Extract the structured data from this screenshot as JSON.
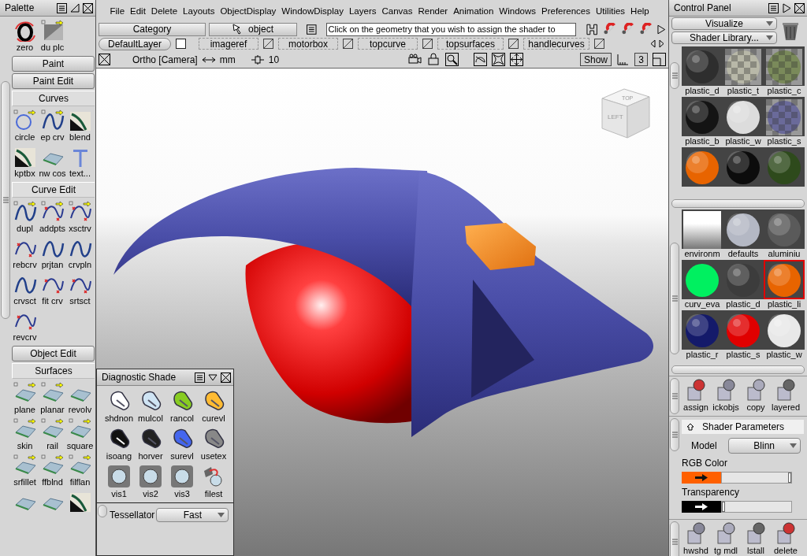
{
  "palette": {
    "title": "Palette",
    "top_tools": [
      {
        "label": "zero",
        "kind": "zero",
        "options": false
      },
      {
        "label": "du plc",
        "kind": "paper",
        "options": true
      }
    ],
    "sections": [
      {
        "title": "Paint",
        "expanded": false
      },
      {
        "title": "Paint Edit",
        "expanded": false
      },
      {
        "title": "Curves",
        "expanded": true,
        "tools": [
          {
            "label": "circle",
            "kind": "circle",
            "options": true
          },
          {
            "label": "ep crv",
            "kind": "curve",
            "options": true
          },
          {
            "label": "blend",
            "kind": "dark",
            "options": false
          },
          {
            "label": "kptbx",
            "kind": "dark",
            "options": false
          },
          {
            "label": "nw cos",
            "kind": "surface",
            "options": false
          },
          {
            "label": "text...",
            "kind": "text",
            "options": false
          }
        ]
      },
      {
        "title": "Curve Edit",
        "expanded": true,
        "tools": [
          {
            "label": "dupl",
            "kind": "curve",
            "options": true
          },
          {
            "label": "addpts",
            "kind": "edit",
            "options": true
          },
          {
            "label": "xsctrv",
            "kind": "edit",
            "options": true
          },
          {
            "label": "rebcrv",
            "kind": "edit",
            "options": false
          },
          {
            "label": "prjtan",
            "kind": "curve",
            "options": false
          },
          {
            "label": "crvpln",
            "kind": "curve",
            "options": false
          },
          {
            "label": "crvsct",
            "kind": "curve",
            "options": false
          },
          {
            "label": "fit crv",
            "kind": "edit",
            "options": false
          },
          {
            "label": "srtsct",
            "kind": "edit",
            "options": false
          },
          {
            "label": "revcrv",
            "kind": "edit",
            "options": false
          }
        ]
      },
      {
        "title": "Object Edit",
        "expanded": false
      },
      {
        "title": "Surfaces",
        "expanded": true,
        "tools": [
          {
            "label": "plane",
            "kind": "surface",
            "options": true
          },
          {
            "label": "planar",
            "kind": "surface",
            "options": true
          },
          {
            "label": "revolv",
            "kind": "surface",
            "options": false
          },
          {
            "label": "skin",
            "kind": "surface",
            "options": true
          },
          {
            "label": "rail",
            "kind": "surface",
            "options": true
          },
          {
            "label": "square",
            "kind": "surface",
            "options": true
          },
          {
            "label": "srfillet",
            "kind": "surface",
            "options": true
          },
          {
            "label": "ffblnd",
            "kind": "surface",
            "options": true
          },
          {
            "label": "filflan",
            "kind": "surface",
            "options": true
          },
          {
            "kind": "surface",
            "options": false
          },
          {
            "kind": "surface",
            "options": false
          },
          {
            "kind": "dark",
            "options": false
          }
        ]
      }
    ]
  },
  "menu": [
    "File",
    "Edit",
    "Delete",
    "Layouts",
    "ObjectDisplay",
    "WindowDisplay",
    "Layers",
    "Canvas",
    "Render",
    "Animation",
    "Windows",
    "Preferences",
    "Utilities",
    "Help"
  ],
  "toolbar": {
    "category": "Category",
    "pick_mode": "object",
    "prompt": "Click on the geometry that you wish to assign the shader to"
  },
  "layers": [
    {
      "name": "DefaultLayer",
      "kind": "default",
      "checked": false
    },
    {
      "name": "imageref",
      "kind": "layer"
    },
    {
      "name": "motorbox",
      "kind": "layer"
    },
    {
      "name": "topcurve",
      "kind": "layer"
    },
    {
      "name": "topsurfaces",
      "kind": "layer"
    },
    {
      "name": "handlecurves",
      "kind": "layer"
    }
  ],
  "view_bar": {
    "camera": "Ortho [Camera]",
    "units": "mm",
    "grid": "10",
    "show": "Show",
    "count": "3"
  },
  "viewport": {
    "view_cube": [
      "TOP",
      "LEFT"
    ]
  },
  "diagnostic": {
    "title": "Diagnostic Shade",
    "tools": [
      "shdnon",
      "mulcol",
      "rancol",
      "curevl",
      "isoang",
      "horver",
      "surevl",
      "usetex",
      "vis1",
      "vis2",
      "vis3",
      "filest"
    ],
    "tessellator_label": "Tessellator",
    "tessellator": "Fast"
  },
  "control_panel": {
    "title": "Control Panel",
    "mode": "Visualize",
    "library": "Shader Library...",
    "libraries": [
      {
        "swatches": [
          {
            "label": "plastic_d",
            "kind": "sphere",
            "color": "#2e2e2e",
            "selected": false
          },
          {
            "label": "plastic_t",
            "kind": "checker",
            "color": "#b8b8a8",
            "selected": false
          },
          {
            "label": "plastic_c",
            "kind": "checker",
            "color": "#7a8a5a",
            "selected": false
          },
          {
            "label": "plastic_b",
            "kind": "sphere",
            "color": "#141414",
            "selected": false
          },
          {
            "label": "plastic_w",
            "kind": "sphere",
            "color": "#dcdcdc",
            "selected": false
          },
          {
            "label": "plastic_s",
            "kind": "checker",
            "color": "#6a6a9a",
            "selected": false
          },
          {
            "kind": "sphere",
            "color": "#e86400",
            "selected": false
          },
          {
            "kind": "sphere",
            "color": "#0c0c0c",
            "selected": false
          },
          {
            "kind": "sphere",
            "color": "#2e4a1c",
            "selected": false
          }
        ]
      },
      {
        "swatches": [
          {
            "label": "environm",
            "kind": "ramp",
            "color": "#ffffff",
            "selected": false
          },
          {
            "label": "defaults",
            "kind": "sphere",
            "color": "#b4b8c4",
            "selected": false
          },
          {
            "label": "aluminiu",
            "kind": "sphere",
            "color": "#5a5a5a",
            "selected": false
          },
          {
            "label": "curv_eva",
            "kind": "flat",
            "color": "#00f060",
            "selected": false
          },
          {
            "label": "plastic_d",
            "kind": "sphere",
            "color": "#3c3c3c",
            "selected": false
          },
          {
            "label": "plastic_li",
            "kind": "sphere",
            "color": "#e86400",
            "selected": true
          },
          {
            "label": "plastic_r",
            "kind": "sphere",
            "color": "#141a6a",
            "selected": false
          },
          {
            "label": "plastic_s",
            "kind": "sphere",
            "color": "#e00000",
            "selected": false
          },
          {
            "label": "plastic_w",
            "kind": "sphere",
            "color": "#e8e8e8",
            "selected": false
          }
        ]
      }
    ],
    "shelf": [
      "assign",
      "ickobjs",
      "copy",
      "layered"
    ],
    "shader_parameters": {
      "title": "Shader Parameters",
      "model_label": "Model",
      "model": "Blinn",
      "rgb": {
        "label": "RGB Color",
        "color": "#ff6000",
        "level": 1
      },
      "transparency": {
        "label": "Transparency",
        "color": "#000000",
        "level": 0
      }
    },
    "bottom_shelf": [
      "hwshd",
      "tg mdl",
      "lstall",
      "delete"
    ]
  }
}
